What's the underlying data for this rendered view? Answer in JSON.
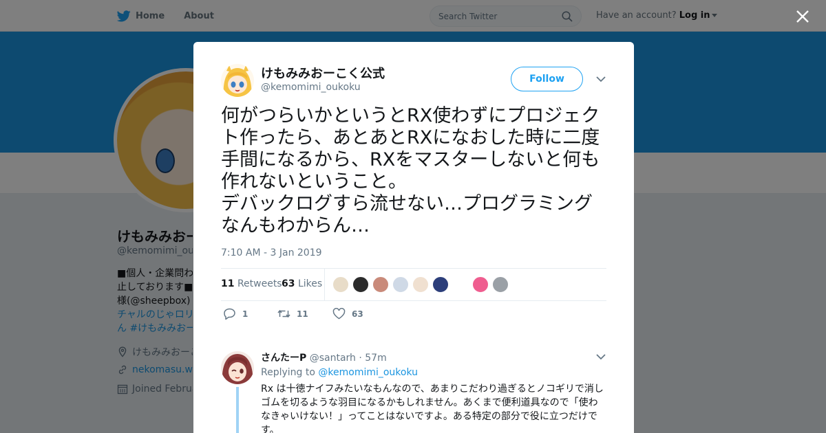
{
  "topbar": {
    "home_label": "Home",
    "about_label": "About",
    "search_placeholder": "Search Twitter",
    "have_account": "Have an account?",
    "login_label": "Log in"
  },
  "profile": {
    "name": "けもみみおーこく公式",
    "handle": "@kemomimi_oukoku",
    "bio_lines": [
      {
        "text": "■個人・企業問わず"
      },
      {
        "text": "止しております■"
      },
      {
        "text": "様(@sheepbox)【"
      },
      {
        "text": "チャルのじゃロリ"
      },
      {
        "text": "ん #けもみみおー"
      }
    ],
    "location": "けもみみおーこく",
    "website": "nekomasu.wix",
    "joined": "Joined Februa"
  },
  "tweet": {
    "author_name": "けもみみおーこく公式",
    "author_handle": "@kemomimi_oukoku",
    "follow_label": "Follow",
    "text": "何がつらいかというとRX使わずにプロジェクト作ったら、あとあとRXになおした時に二度手間になるから、RXをマスターしないと何も作れないということ。\nデバックログすら流せない…プログラミングなんもわからん…",
    "timestamp": "7:10 AM - 3 Jan 2019",
    "retweets_count": "11",
    "retweets_label": "Retweets",
    "likes_count": "63",
    "likes_label": "Likes",
    "liker_colors": [
      "#e8dcc8",
      "#2b2b2b",
      "#c98a7a",
      "#cfd9e6",
      "#f0e0d0",
      "#2c3e7a",
      "#ffffff",
      "#ef5d8f",
      "#9aa0a6"
    ],
    "actions": {
      "reply_count": "1",
      "retweet_count": "11",
      "like_count": "63"
    }
  },
  "reply": {
    "author_name": "さんたーP",
    "author_handle": "@santarh",
    "time": "· 57m",
    "replying_prefix": "Replying to",
    "replying_to": "@kemomimi_oukoku",
    "text": "Rx は十徳ナイフみたいなもんなので、あまりこだわり過ぎるとノコギリで消しゴムを切るような羽目になるかもしれません。あくまで便利道具なので「使わなきゃいけない！」ってことはないですよ。ある特定の部分で役に立つだけです。"
  },
  "colors": {
    "accent": "#1da1f2",
    "banner": "#1b95e0",
    "link": "#1b95e0",
    "muted": "#657786"
  }
}
